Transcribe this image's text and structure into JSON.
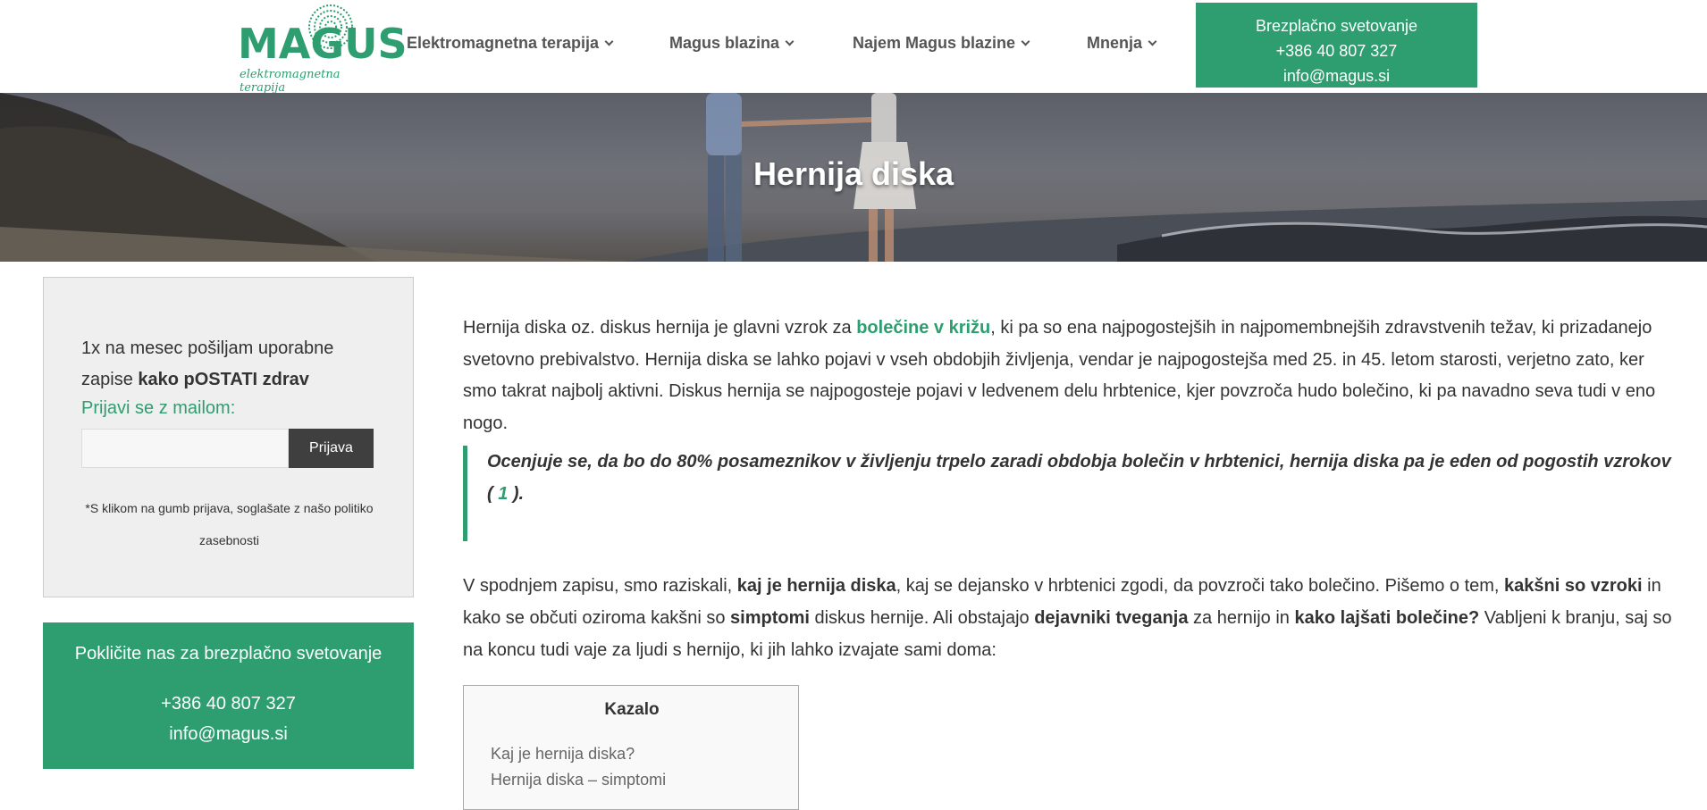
{
  "header": {
    "logo": {
      "word": "MAGUS",
      "tagline": "elektromagnetna terapija"
    },
    "nav": [
      {
        "label": "Elektromagnetna terapija"
      },
      {
        "label": "Magus blazina"
      },
      {
        "label": "Najem Magus blazine"
      },
      {
        "label": "Mnenja"
      }
    ],
    "cta": {
      "line1": "Brezplačno svetovanje",
      "phone": "+386 40 807 327",
      "email": "info@magus.si"
    }
  },
  "hero": {
    "title": "Hernija diska"
  },
  "newsletter": {
    "text_plain": "1x na mesec pošiljam uporabne zapise",
    "text_bold": "kako pOSTATI zdrav",
    "label": "Prijavi se z mailom:",
    "input_value": "",
    "button": "Prijava",
    "note": "*S klikom na gumb prijava, soglašate z našo politiko zasebnosti"
  },
  "call_box": {
    "title": "Pokličite nas za brezplačno svetovanje",
    "phone": "+386 40 807 327",
    "email": "info@magus.si"
  },
  "article": {
    "p1_before": "Hernija diska oz. diskus hernija je glavni vzrok za ",
    "p1_link": "bolečine v križu",
    "p1_after": ", ki pa so ena najpogostejših in najpomembnejših zdravstvenih težav, ki prizadanejo svetovno prebivalstvo. Hernija diska se lahko pojavi v vseh obdobjih življenja, vendar je najpogostejša med 25. in 45. letom starosti, verjetno zato, ker smo takrat najbolj aktivni. Diskus hernija se najpogosteje pojavi v ledvenem delu hrbtenice, kjer povzroča hudo bolečino, ki pa navadno seva tudi v eno nogo.",
    "quote_text": "Ocenjuje se, da bo do 80%  posameznikov v življenju trpelo zaradi obdobja bolečin v hrbtenici, hernija diska pa je eden od pogostih vzrokov",
    "quote_ref_open": "( ",
    "quote_ref": "1",
    "quote_ref_close": " ).",
    "p2": {
      "t1": "V spodnjem zapisu, smo raziskali, ",
      "b1": "kaj je hernija diska",
      "t2": ", kaj se dejansko v hrbtenici zgodi, da povzroči tako bolečino. Pišemo o tem, ",
      "b2": "kakšni so vzroki",
      "t3": " in kako se občuti oziroma kakšni so ",
      "b3": "simptomi",
      "t4": " diskus hernije. Ali obstajajo ",
      "b4": "dejavniki tveganja",
      "t5": " za hernijo in ",
      "b5": "kako lajšati bolečine?",
      "t6": " Vabljeni k branju, saj so na koncu tudi vaje za ljudi s hernijo, ki jih lahko izvajate sami doma:"
    }
  },
  "toc": {
    "title": "Kazalo",
    "items": [
      "Kaj je hernija diska?",
      "Hernija diska – simptomi"
    ]
  },
  "colors": {
    "brand_green": "#2e9e70",
    "button_dark": "#3f3f3f",
    "sidebar_bg": "#efefef"
  }
}
